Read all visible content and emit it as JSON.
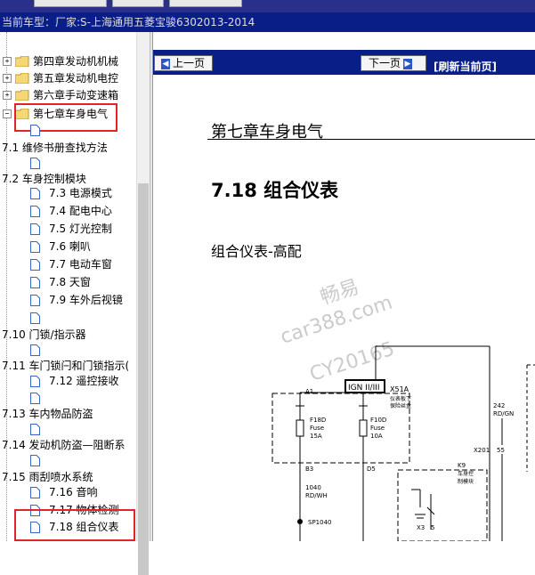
{
  "header": {
    "model_label": "当前车型：",
    "model_value": "厂家:S-上海通用五菱宝骏6302013-2014"
  },
  "nav": {
    "prev": "上一页",
    "next": "下一页",
    "refresh": "[刷新当前页]"
  },
  "tree": {
    "chapters": [
      "第四章发动机机械",
      "第五章发动机电控",
      "第六章手动变速箱",
      "第七章车身电气"
    ],
    "items": [
      "7.1 维修书册查找方法",
      "7.2 车身控制模块",
      "7.3 电源模式",
      "7.4 配电中心",
      "7.5 灯光控制",
      "7.6 喇叭",
      "7.7 电动车窗",
      "7.8 天窗",
      "7.9 车外后视镜",
      "7.10 门锁/指示器",
      "7.11 车门锁闩和门锁指示(",
      "7.12 遥控接收",
      "7.13 车内物品防盗",
      "7.14 发动机防盗—阻断系",
      "7.15 雨刮喷水系统",
      "7.16 音响",
      "7.17 物体检测",
      "7.18 组合仪表"
    ]
  },
  "doc": {
    "chapter_title": "第七章车身电气",
    "section_title": "7.18 组合仪表",
    "subtitle": "组合仪表-高配"
  },
  "watermark": {
    "line1": "畅易",
    "line2": "car388.com",
    "line3": "CY20165"
  },
  "diagram": {
    "ign": "IGN II/III",
    "x51a": "X51A",
    "x51a_desc1": "仪表板下",
    "x51a_desc2": "保险丝盒",
    "a1": "A1",
    "f18d": "F18D",
    "f18d_fuse": "Fuse",
    "f18d_amp": "15A",
    "f10d": "F10D",
    "f10d_fuse": "Fuse",
    "f10d_amp": "10A",
    "b3": "B3",
    "d5": "D5",
    "w1040": "1040",
    "w1040_color": "RD/WH",
    "sp1040": "SP1040",
    "w242": "242",
    "w242_color": "RD/GN",
    "x201": "X201",
    "p55": "55",
    "k9": "K9",
    "k9_desc1": "车身控",
    "k9_desc2": "制模块",
    "x3": "X3",
    "p5": "5"
  },
  "colors": {
    "nav_bg": "#0a1e88",
    "highlight": "#e0242a"
  }
}
